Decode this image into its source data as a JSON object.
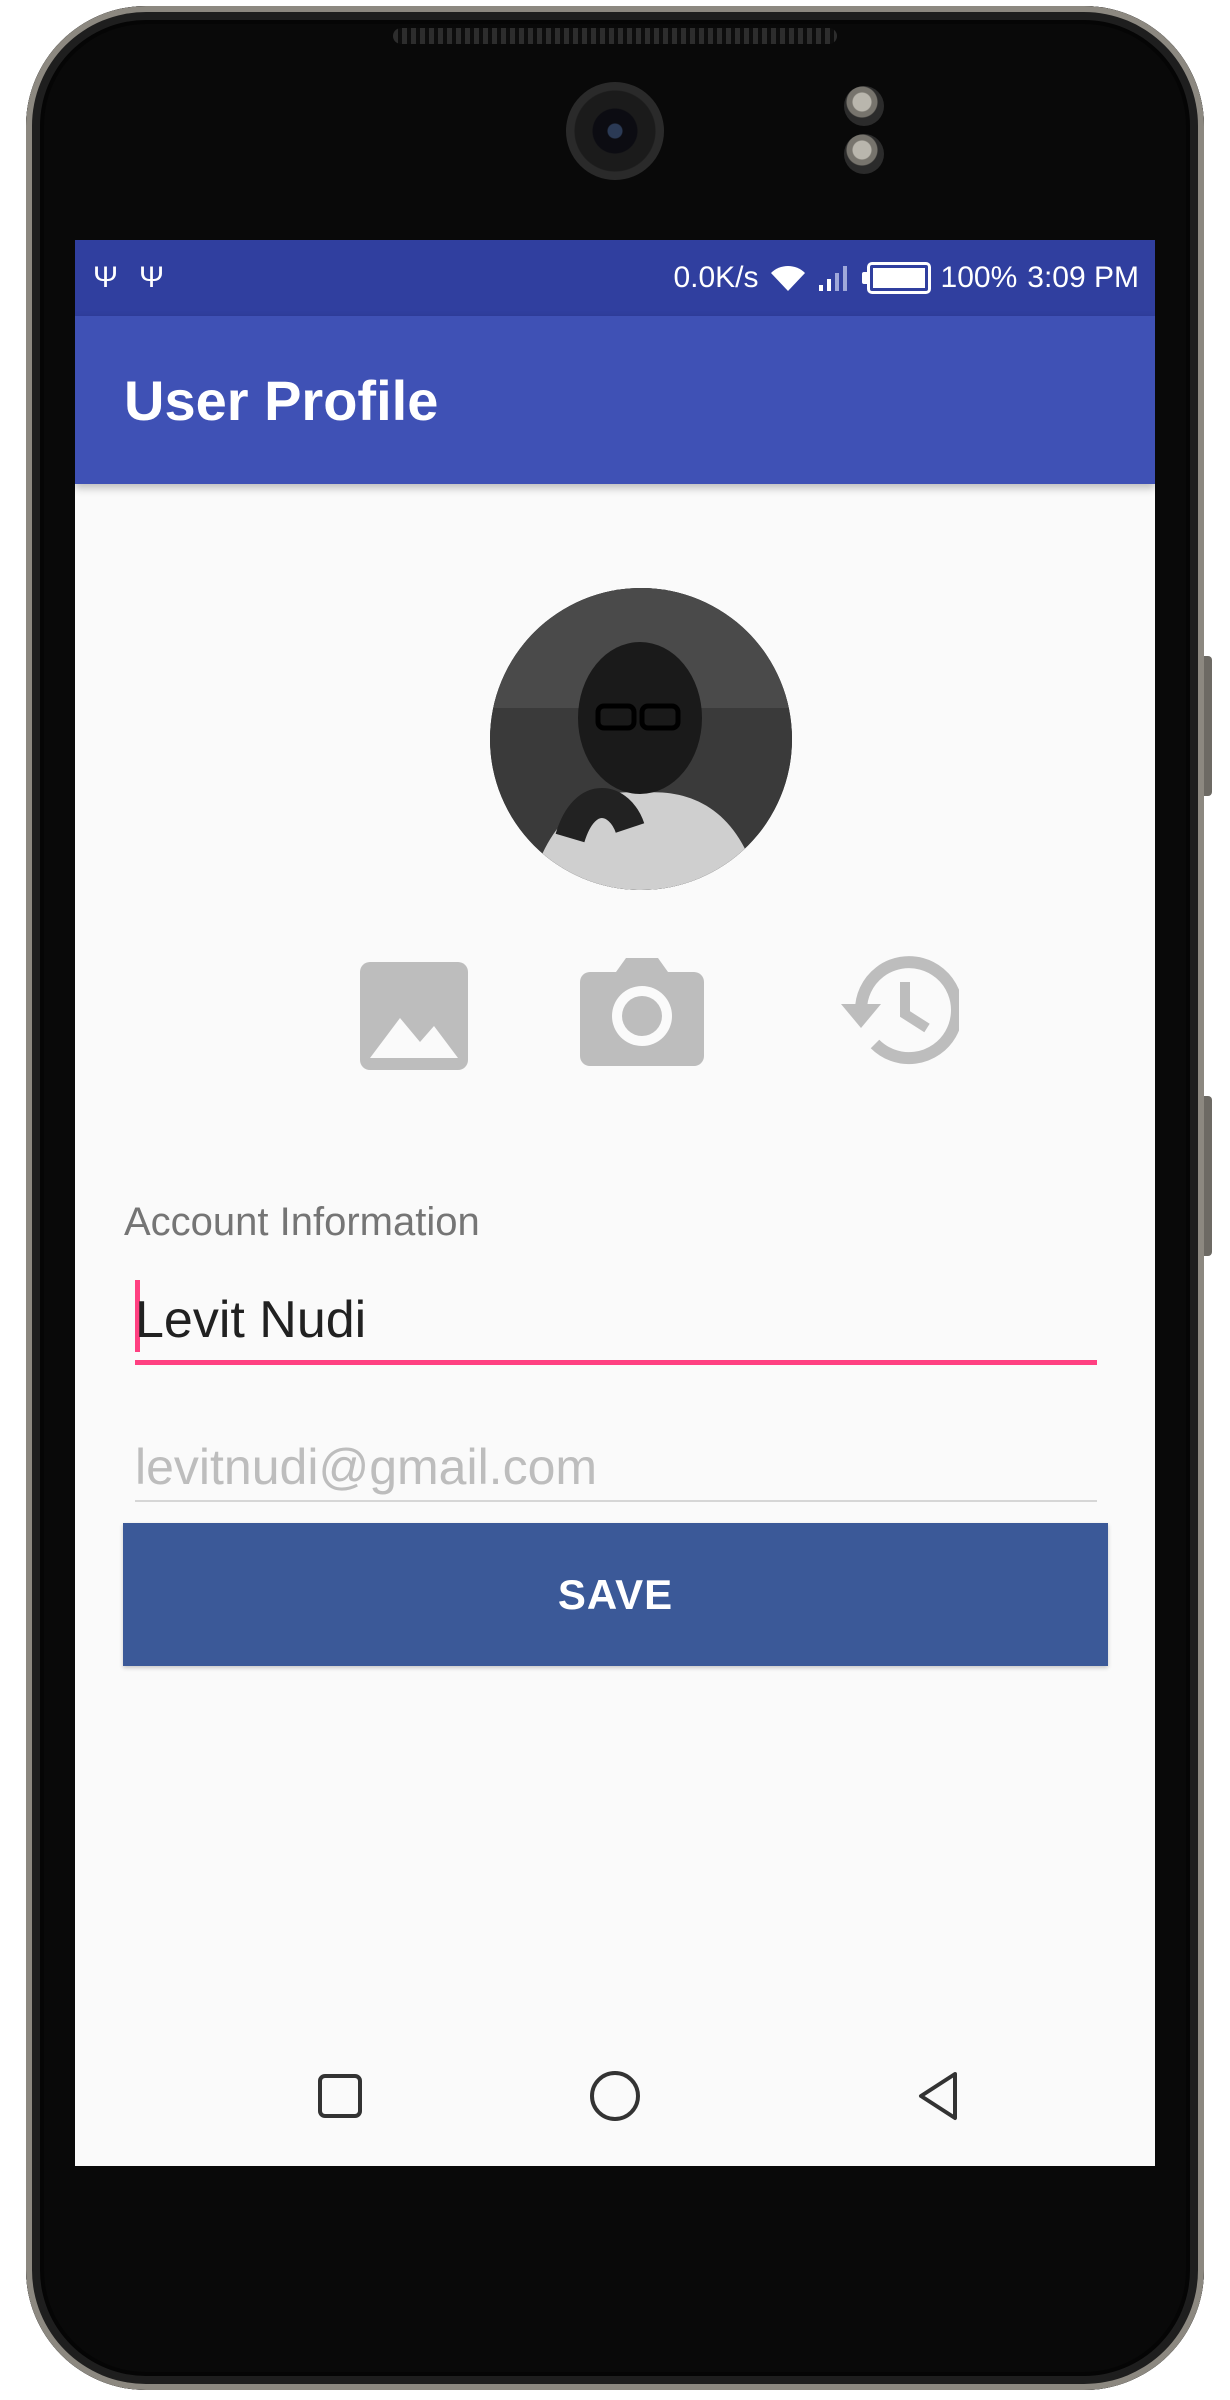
{
  "status_bar": {
    "usb_icons": [
      "usb-icon",
      "usb-icon"
    ],
    "speed": "0.0K/s",
    "battery_percent": "100%",
    "time": "3:09 PM",
    "icons": [
      "wifi-icon",
      "signal-icon",
      "battery-icon"
    ]
  },
  "app_bar": {
    "title": "User Profile"
  },
  "profile": {
    "avatar": "profile-photo",
    "actions": [
      {
        "icon": "gallery-icon"
      },
      {
        "icon": "camera-icon"
      },
      {
        "icon": "history-icon"
      }
    ]
  },
  "form": {
    "section_label": "Account Information",
    "name_value": "Levit Nudi",
    "email_placeholder": "levitnudi@gmail.com",
    "save_label": "SAVE"
  },
  "nav_bar": {
    "buttons": [
      "recent-apps-icon",
      "home-icon",
      "back-icon"
    ]
  },
  "colors": {
    "status_bar": "#303f9f",
    "app_bar": "#3f51b5",
    "accent": "#ff4081",
    "save_button": "#3b5998",
    "icon_gray": "#bdbdbd"
  }
}
